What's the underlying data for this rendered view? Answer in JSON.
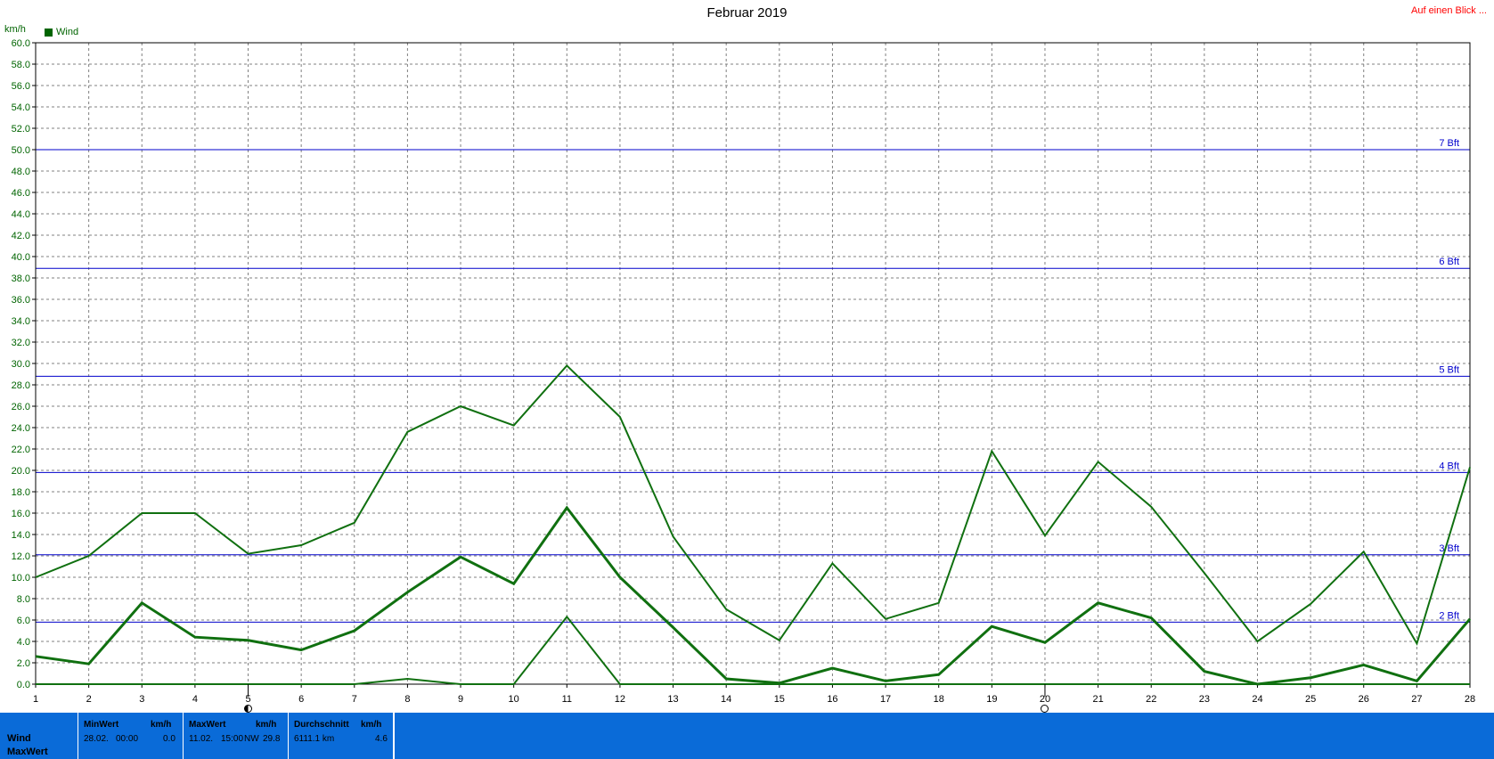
{
  "title": "Februar 2019",
  "link_label": "Auf einen Blick ...",
  "unit": "km/h",
  "legend": [
    {
      "label": "Wind",
      "color": "#006400"
    }
  ],
  "chart_data": {
    "type": "line",
    "title": "Februar 2019",
    "ylabel": "km/h",
    "ylim": [
      0,
      60
    ],
    "y_ticks": [
      "0.0",
      "2.0",
      "4.0",
      "6.0",
      "8.0",
      "10.0",
      "12.0",
      "14.0",
      "16.0",
      "18.0",
      "20.0",
      "22.0",
      "24.0",
      "26.0",
      "28.0",
      "30.0",
      "32.0",
      "34.0",
      "36.0",
      "38.0",
      "40.0",
      "42.0",
      "44.0",
      "46.0",
      "48.0",
      "50.0",
      "52.0",
      "54.0",
      "56.0",
      "58.0",
      "60.0"
    ],
    "x": [
      "1",
      "2",
      "3",
      "4",
      "5",
      "6",
      "7",
      "8",
      "9",
      "10",
      "11",
      "12",
      "13",
      "14",
      "15",
      "16",
      "17",
      "18",
      "19",
      "20",
      "21",
      "22",
      "23",
      "24",
      "25",
      "26",
      "27",
      "28"
    ],
    "grid": true,
    "legend_position": "top-left",
    "series": [
      {
        "role": "max",
        "color": "#107010",
        "width": 2,
        "values": [
          10.0,
          12.0,
          16.0,
          16.0,
          12.2,
          13.0,
          15.1,
          23.6,
          26.0,
          24.2,
          29.8,
          25.0,
          13.8,
          7.0,
          4.1,
          11.3,
          6.1,
          7.6,
          21.8,
          13.9,
          20.8,
          16.6,
          10.4,
          4.0,
          7.5,
          12.4,
          3.8,
          20.3
        ]
      },
      {
        "role": "average",
        "color": "#107010",
        "width": 3,
        "values": [
          2.6,
          1.9,
          7.6,
          4.4,
          4.1,
          3.2,
          5.0,
          8.6,
          11.9,
          9.4,
          16.5,
          10.0,
          5.3,
          0.5,
          0.1,
          1.5,
          0.3,
          0.9,
          5.4,
          3.9,
          7.6,
          6.2,
          1.2,
          0.0,
          0.6,
          1.8,
          0.3,
          6.1
        ]
      },
      {
        "role": "min",
        "color": "#107010",
        "width": 2,
        "values": [
          0.0,
          0.0,
          0.0,
          0.0,
          0.0,
          0.0,
          0.0,
          0.5,
          0.0,
          0.0,
          6.3,
          0.0,
          0.0,
          0.0,
          0.0,
          0.0,
          0.0,
          0.0,
          0.0,
          0.0,
          0.0,
          0.0,
          0.0,
          0.0,
          0.0,
          0.0,
          0.0,
          0.0
        ]
      }
    ],
    "reference_lines": [
      {
        "value": 5.8,
        "label": "2 Bft"
      },
      {
        "value": 12.1,
        "label": "3 Bft"
      },
      {
        "value": 19.8,
        "label": "4 Bft"
      },
      {
        "value": 28.8,
        "label": "5 Bft"
      },
      {
        "value": 38.9,
        "label": "6 Bft"
      },
      {
        "value": 50.0,
        "label": "7 Bft"
      }
    ],
    "reference_color": "#0000cc",
    "moon_phases": [
      {
        "day": 5,
        "phase": "new"
      },
      {
        "day": 20,
        "phase": "full"
      }
    ]
  },
  "panel": {
    "row_label_1": "Wind",
    "row_label_2": "MaxWert",
    "min": {
      "header": "MinWert",
      "unit": "km/h",
      "date": "28.02.",
      "time": "00:00",
      "value": "0.0"
    },
    "max": {
      "header": "MaxWert",
      "unit": "km/h",
      "date": "11.02.",
      "time": "15:00",
      "dir": "NW",
      "value": "29.8"
    },
    "avg": {
      "header": "Durchschnitt",
      "unit": "km/h",
      "distance": "6111.1 km",
      "value": "4.6"
    }
  }
}
